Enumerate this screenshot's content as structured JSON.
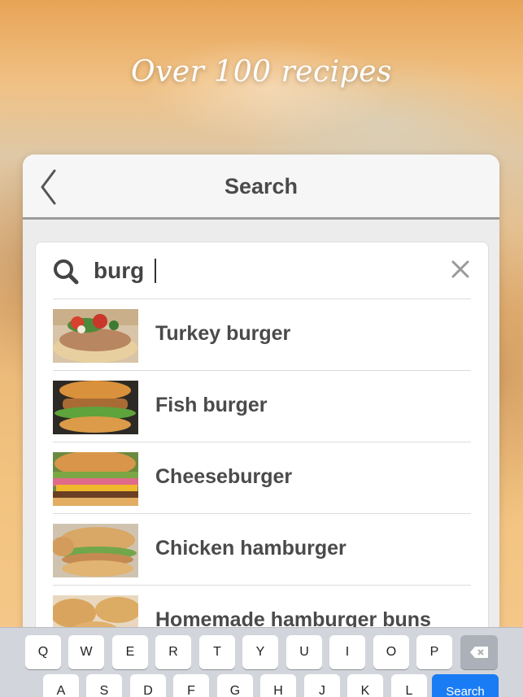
{
  "headline": "Over 100 recipes",
  "navbar": {
    "title": "Search",
    "back_icon": "chevron-left-icon"
  },
  "search": {
    "value": "burg",
    "search_icon": "magnifier-icon",
    "clear_icon": "close-icon"
  },
  "results": [
    {
      "label": "Turkey burger",
      "thumb": "turkey-burger"
    },
    {
      "label": "Fish burger",
      "thumb": "fish-burger"
    },
    {
      "label": "Cheeseburger",
      "thumb": "cheeseburger"
    },
    {
      "label": "Chicken hamburger",
      "thumb": "chicken-hamburger"
    },
    {
      "label": "Homemade hamburger buns",
      "thumb": "hamburger-buns"
    }
  ],
  "keyboard": {
    "row1": [
      "Q",
      "W",
      "E",
      "R",
      "T",
      "Y",
      "U",
      "I",
      "O",
      "P"
    ],
    "row2": [
      "A",
      "S",
      "D",
      "F",
      "G",
      "H",
      "J",
      "K",
      "L"
    ],
    "search_label": "Search",
    "backspace_icon": "backspace-icon"
  },
  "colors": {
    "accent": "#1a7cf5",
    "text": "#4a4a4a",
    "headline": "#ffffff"
  }
}
